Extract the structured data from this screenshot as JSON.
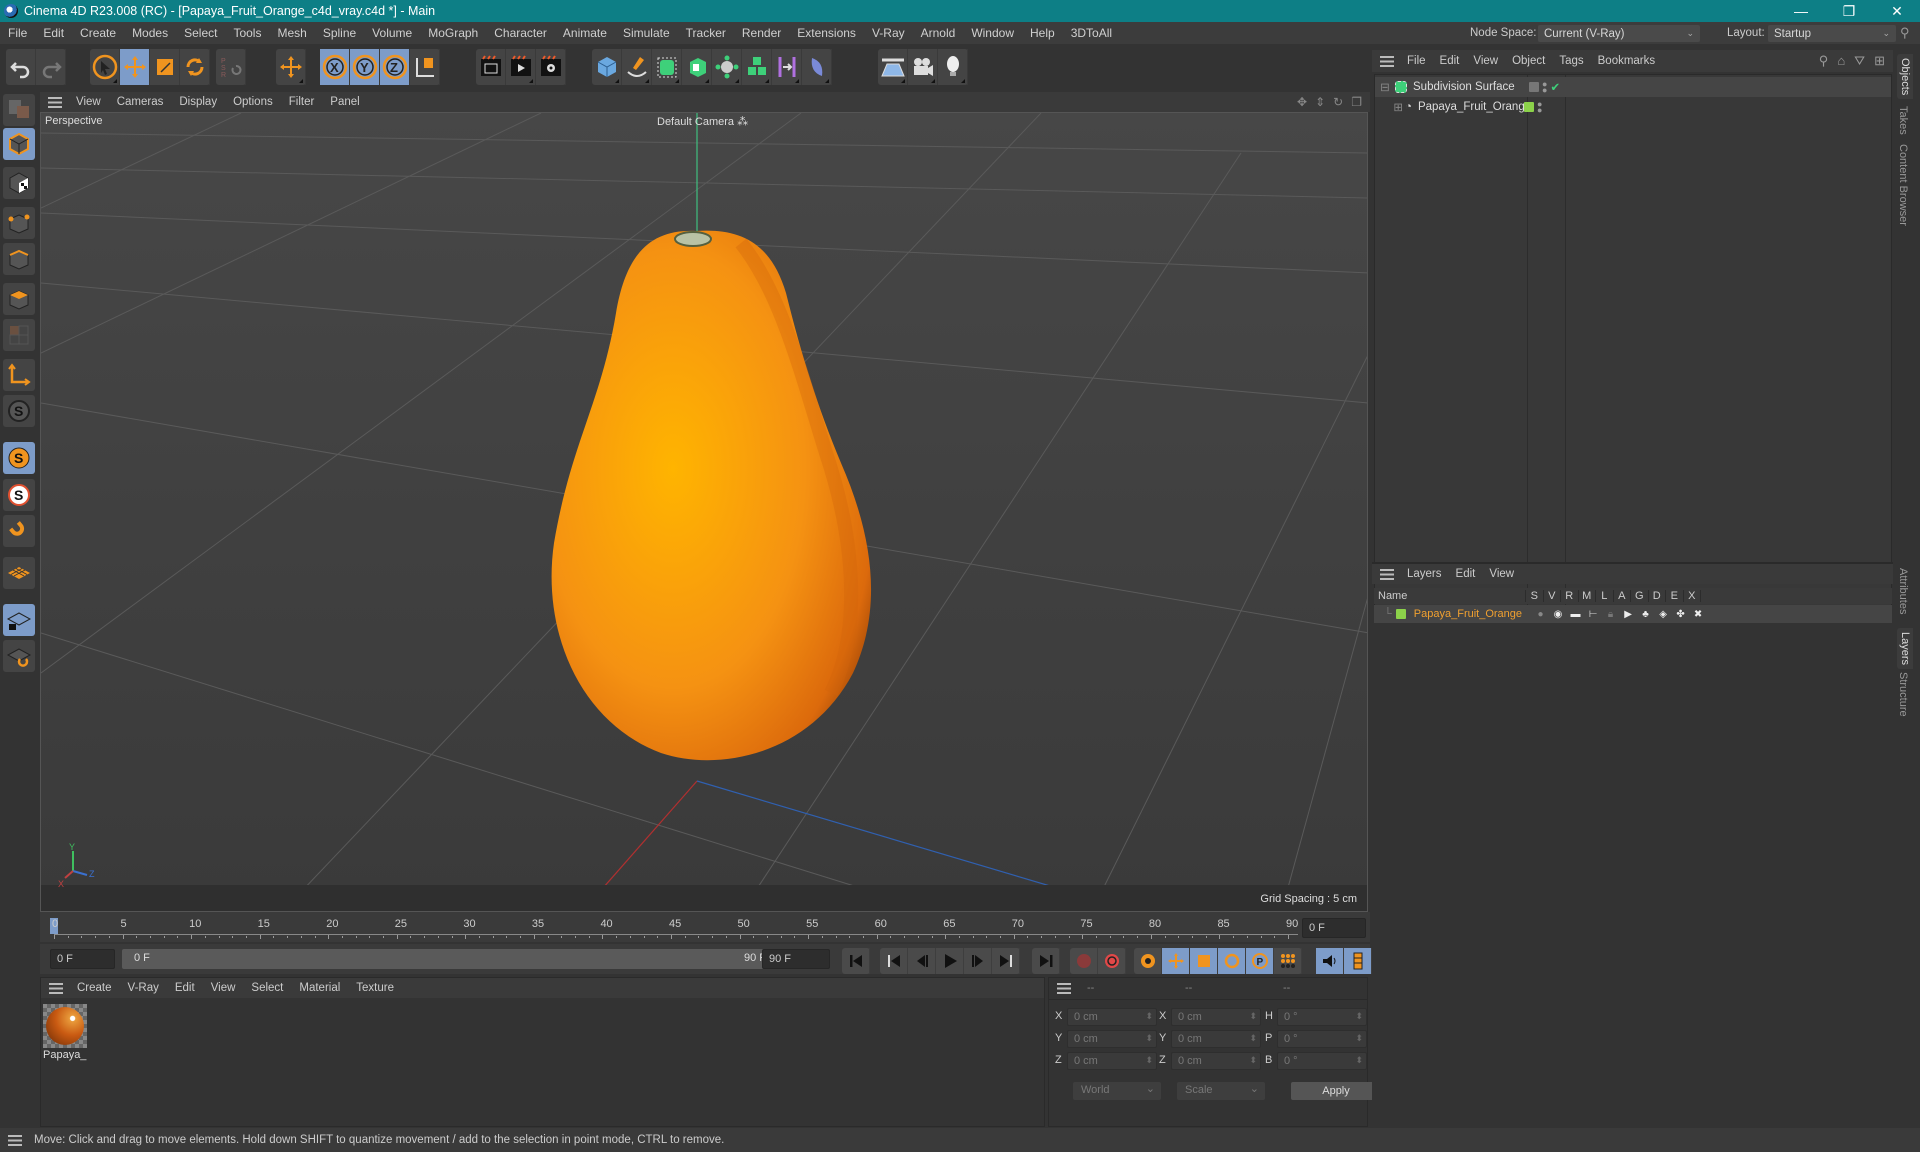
{
  "window": {
    "title": "Cinema 4D R23.008 (RC) - [Papaya_Fruit_Orange_c4d_vray.c4d *] - Main",
    "controls": {
      "minimize": "—",
      "restore": "❐",
      "close": "✕"
    }
  },
  "menubar": {
    "items": [
      "File",
      "Edit",
      "Create",
      "Modes",
      "Select",
      "Tools",
      "Mesh",
      "Spline",
      "Volume",
      "MoGraph",
      "Character",
      "Animate",
      "Simulate",
      "Tracker",
      "Render",
      "Extensions",
      "V-Ray",
      "Arnold",
      "Window",
      "Help",
      "3DToAll"
    ],
    "node_space_label": "Node Space:",
    "node_space_value": "Current (V-Ray)",
    "layout_label": "Layout:",
    "layout_value": "Startup"
  },
  "toolbar": {
    "groups": [
      [
        "undo-icon",
        "redo-icon"
      ],
      [
        "select-arrow-icon",
        "move-icon",
        "scale-icon",
        "rotate-icon"
      ],
      [
        "psr-icon"
      ],
      [
        "axis-move-icon"
      ],
      [
        "x-axis-icon",
        "y-axis-icon",
        "z-axis-icon",
        "coordinate-system-icon"
      ],
      [
        "render-view-icon",
        "render-picture-viewer-icon",
        "render-settings-icon"
      ],
      [
        "cube-icon",
        "pen-icon",
        "subdivision-icon",
        "extrude-icon",
        "cloner-icon",
        "mograph-icon",
        "deformer-icon",
        "field-icon"
      ],
      [
        "floor-icon",
        "camera-icon",
        "light-icon"
      ]
    ]
  },
  "lefttools": [
    "make-editable-icon",
    "model-mode-icon",
    "texture-mode-icon",
    "point-mode-icon",
    "edge-mode-icon",
    "polygon-mode-icon",
    "uvw-mode-icon",
    "axis-mode-icon",
    "snap-icon",
    "snap-settings-icon",
    "snap-enable-icon",
    "magnet-icon",
    "workplane-icon",
    "locked-workplane-icon",
    "workplane-rotate-icon"
  ],
  "viewport": {
    "menu": [
      "View",
      "Cameras",
      "Display",
      "Options",
      "Filter",
      "Panel"
    ],
    "label": "Perspective",
    "camera": "Default Camera",
    "grid_spacing": "Grid Spacing : 5 cm",
    "axis_labels": {
      "x": "X",
      "y": "Y",
      "z": "Z"
    },
    "object_colors": {
      "papaya_light": "#ffb000",
      "papaya_mid": "#f58c10",
      "papaya_dark": "#c85a0a",
      "stem": "#b9c2a4"
    }
  },
  "timeline": {
    "ticks": [
      "0",
      "5",
      "10",
      "15",
      "20",
      "25",
      "30",
      "35",
      "40",
      "45",
      "50",
      "55",
      "60",
      "65",
      "70",
      "75",
      "80",
      "85",
      "90"
    ],
    "current_frame_field": "0 F",
    "start_field": "0 F",
    "range_start": "0 F",
    "range_end": "90 F",
    "end_field": "90 F",
    "current_frame": 0,
    "max_frame": 90
  },
  "materials": {
    "menu": [
      "Create",
      "V-Ray",
      "Edit",
      "View",
      "Select",
      "Material",
      "Texture"
    ],
    "items": [
      {
        "name": "Papaya_Fruit_Orange",
        "short_label": "Papaya_("
      }
    ]
  },
  "coordinates": {
    "headers": [
      "--",
      "--",
      "--"
    ],
    "rows": [
      {
        "pos_axis": "X",
        "pos": "0 cm",
        "size_axis": "X",
        "size": "0 cm",
        "rot_axis": "H",
        "rot": "0 °"
      },
      {
        "pos_axis": "Y",
        "pos": "0 cm",
        "size_axis": "Y",
        "size": "0 cm",
        "rot_axis": "P",
        "rot": "0 °"
      },
      {
        "pos_axis": "Z",
        "pos": "0 cm",
        "size_axis": "Z",
        "size": "0 cm",
        "rot_axis": "B",
        "rot": "0 °"
      }
    ],
    "space_dropdown": "World",
    "mode_dropdown": "Scale",
    "apply_label": "Apply"
  },
  "objects": {
    "menu": [
      "File",
      "Edit",
      "View",
      "Object",
      "Tags",
      "Bookmarks"
    ],
    "items": [
      {
        "name": "Subdivision Surface",
        "icon": "subdivision-icon",
        "layer_color": null,
        "enabled": true
      },
      {
        "name": "Papaya_Fruit_Orange",
        "icon": "polygon-object-icon",
        "layer_color": "#8cd24a"
      }
    ]
  },
  "layers": {
    "menu": [
      "Layers",
      "Edit",
      "View"
    ],
    "columns": [
      "Name",
      "S",
      "V",
      "R",
      "M",
      "L",
      "A",
      "G",
      "D",
      "E",
      "X"
    ],
    "items": [
      {
        "name": "Papaya_Fruit_Orange",
        "color": "#8cd24a",
        "name_color": "#f0a030"
      }
    ]
  },
  "side_tabs": {
    "top": [
      "Objects",
      "Takes",
      "Content Browser"
    ],
    "bottom": [
      "Attributes",
      "Layers",
      "Structure"
    ]
  },
  "status": "Move: Click and drag to move elements. Hold down SHIFT to quantize movement / add to the selection in point mode, CTRL to remove."
}
